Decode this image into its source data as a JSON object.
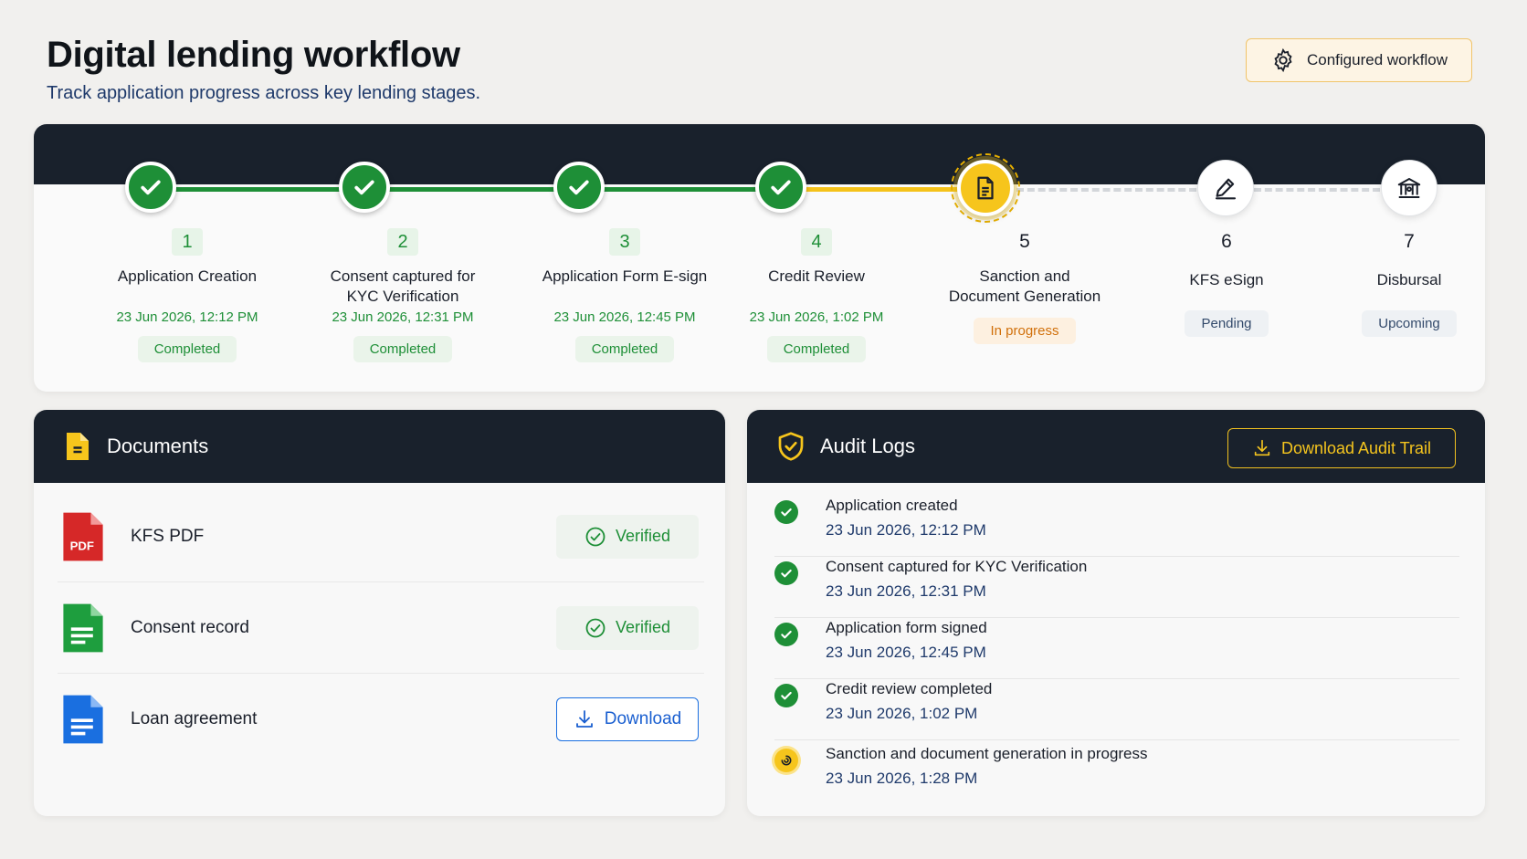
{
  "header": {
    "title": "Digital lending workflow",
    "subtitle": "Track application progress across key lending stages.",
    "config_button": "Configured workflow"
  },
  "steps": [
    {
      "num": "1",
      "title": "Application Creation",
      "time": "23 Jun 2026, 12:12 PM",
      "status": "Completed",
      "state": "done"
    },
    {
      "num": "2",
      "title": "Consent captured for KYC Verification",
      "time": "23 Jun 2026, 12:31 PM",
      "status": "Completed",
      "state": "done"
    },
    {
      "num": "3",
      "title": "Application Form E-sign",
      "time": "23 Jun 2026, 12:45 PM",
      "status": "Completed",
      "state": "done"
    },
    {
      "num": "4",
      "title": "Credit Review",
      "time": "23 Jun 2026, 1:02 PM",
      "status": "Completed",
      "state": "done"
    },
    {
      "num": "5",
      "title": "Sanction and Document Generation",
      "time": "",
      "status": "In progress",
      "state": "active"
    },
    {
      "num": "6",
      "title": "KFS eSign",
      "time": "",
      "status": "Pending",
      "state": "pending"
    },
    {
      "num": "7",
      "title": "Disbursal",
      "time": "",
      "status": "Upcoming",
      "state": "pending"
    }
  ],
  "documents": {
    "title": "Documents",
    "items": [
      {
        "name": "KFS PDF",
        "icon": "pdf-file-icon",
        "action": "Verified"
      },
      {
        "name": "Consent record",
        "icon": "sheet-file-icon",
        "action": "Verified"
      },
      {
        "name": "Loan agreement",
        "icon": "doc-file-icon",
        "action": "Download"
      }
    ],
    "pdf_label": "PDF"
  },
  "audit": {
    "title": "Audit Logs",
    "download_button": "Download Audit Trail",
    "logs": [
      {
        "title": "Application created",
        "time": "23 Jun 2026, 12:12 PM",
        "state": "done"
      },
      {
        "title": "Consent captured for KYC Verification",
        "time": "23 Jun 2026, 12:31 PM",
        "state": "done"
      },
      {
        "title": "Application form signed",
        "time": "23 Jun 2026, 12:45 PM",
        "state": "done"
      },
      {
        "title": "Credit review completed",
        "time": "23 Jun 2026, 1:02 PM",
        "state": "done"
      },
      {
        "title": "Sanction and document generation in progress",
        "time": "23 Jun 2026, 1:28 PM",
        "state": "active"
      }
    ]
  },
  "colors": {
    "dark_band": "#19212c",
    "success": "#1e8f37",
    "active": "#f6c51c",
    "accent_blue": "#1a6fe0"
  }
}
